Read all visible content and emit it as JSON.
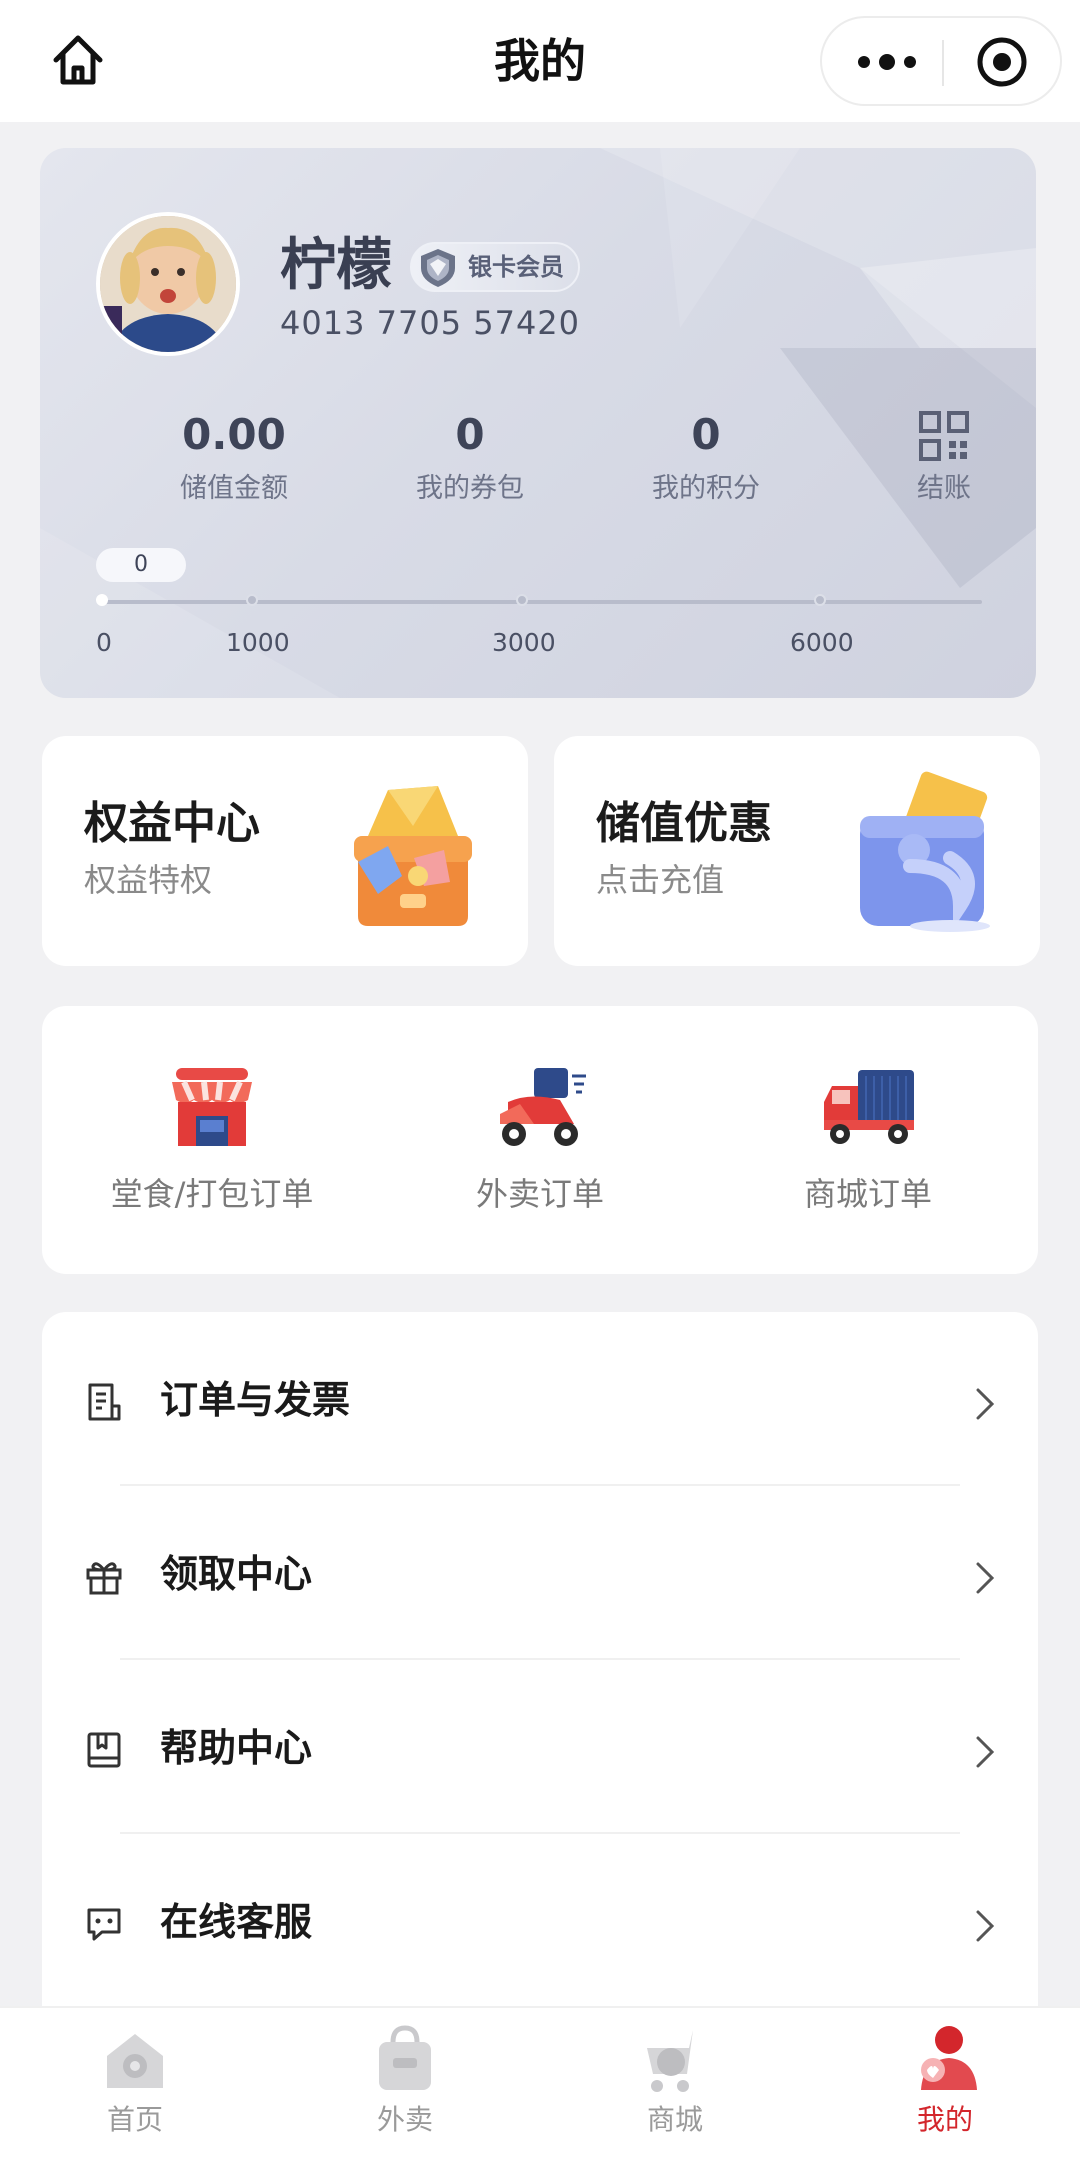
{
  "header": {
    "title": "我的",
    "home_icon": "home-icon",
    "more_icon": "more-dots-icon",
    "close_icon": "target-close-icon"
  },
  "member": {
    "name": "柠檬",
    "level": "银卡会员",
    "card_number": "4013 7705 57420",
    "stats": [
      {
        "value": "0.00",
        "label": "储值金额"
      },
      {
        "value": "0",
        "label": "我的券包"
      },
      {
        "value": "0",
        "label": "我的积分"
      },
      {
        "value": "",
        "label": "结账",
        "icon": "qr-code-icon"
      }
    ],
    "progress": {
      "current": "0",
      "ticks": [
        "0",
        "1000",
        "3000",
        "6000"
      ]
    }
  },
  "promos": [
    {
      "title": "权益中心",
      "subtitle": "权益特权",
      "icon": "treasure-chest-icon"
    },
    {
      "title": "储值优惠",
      "subtitle": "点击充值",
      "icon": "wallet-icon"
    }
  ],
  "orders": [
    {
      "label": "堂食/打包订单",
      "icon": "storefront-icon"
    },
    {
      "label": "外卖订单",
      "icon": "scooter-icon"
    },
    {
      "label": "商城订单",
      "icon": "truck-icon"
    }
  ],
  "menu": [
    {
      "label": "订单与发票",
      "icon": "receipt-icon"
    },
    {
      "label": "领取中心",
      "icon": "gift-icon"
    },
    {
      "label": "帮助中心",
      "icon": "book-icon"
    },
    {
      "label": "在线客服",
      "icon": "chat-icon"
    }
  ],
  "tabs": [
    {
      "label": "首页",
      "icon": "home-tab-icon"
    },
    {
      "label": "外卖",
      "icon": "bag-tab-icon"
    },
    {
      "label": "商城",
      "icon": "cart-tab-icon"
    },
    {
      "label": "我的",
      "icon": "user-tab-icon",
      "active": true
    }
  ],
  "colors": {
    "accent": "#d3262c",
    "card_text": "#3e4458",
    "background": "#f1f1f3"
  }
}
